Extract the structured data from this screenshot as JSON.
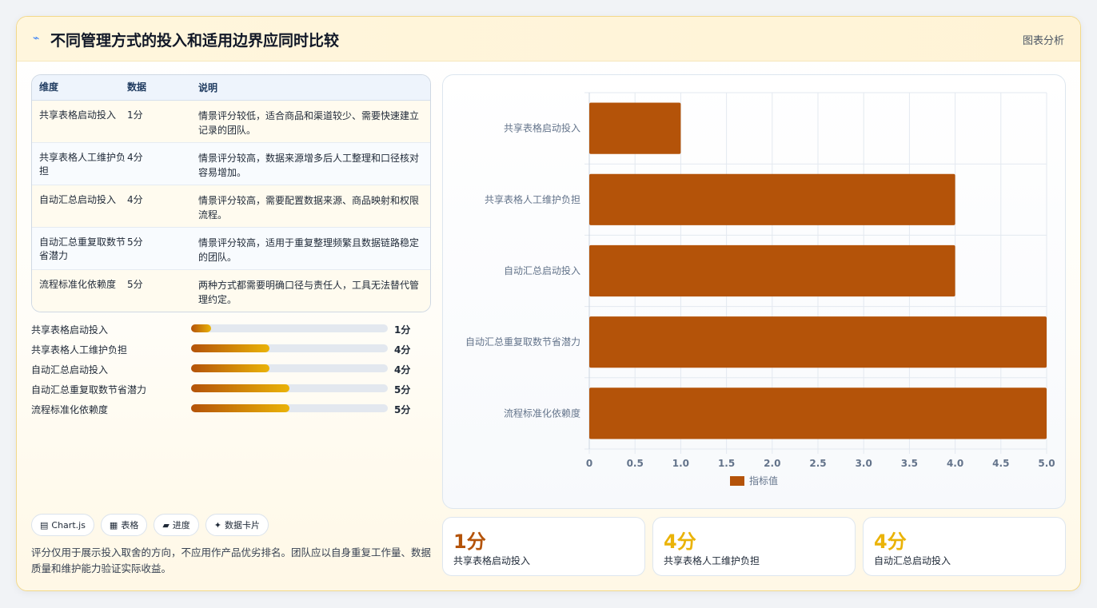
{
  "header": {
    "title": "不同管理方式的投入和适用边界应同时比较",
    "tag": "图表分析",
    "icon": "chart-spark-icon"
  },
  "table": {
    "headers": [
      "维度",
      "数据",
      "说明"
    ],
    "rows": [
      {
        "dim": "共享表格启动投入",
        "val": "1分",
        "desc": "情景评分较低，适合商品和渠道较少、需要快速建立记录的团队。"
      },
      {
        "dim": "共享表格人工维护负担",
        "val": "4分",
        "desc": "情景评分较高，数据来源增多后人工整理和口径核对容易增加。"
      },
      {
        "dim": "自动汇总启动投入",
        "val": "4分",
        "desc": "情景评分较高，需要配置数据来源、商品映射和权限流程。"
      },
      {
        "dim": "自动汇总重复取数节省潜力",
        "val": "5分",
        "desc": "情景评分较高，适用于重复整理频繁且数据链路稳定的团队。"
      },
      {
        "dim": "流程标准化依赖度",
        "val": "5分",
        "desc": "两种方式都需要明确口径与责任人，工具无法替代管理约定。"
      }
    ]
  },
  "progress": [
    {
      "label": "共享表格启动投入",
      "value": 1,
      "text": "1分"
    },
    {
      "label": "共享表格人工维护负担",
      "value": 4,
      "text": "4分"
    },
    {
      "label": "自动汇总启动投入",
      "value": 4,
      "text": "4分"
    },
    {
      "label": "自动汇总重复取数节省潜力",
      "value": 5,
      "text": "5分"
    },
    {
      "label": "流程标准化依赖度",
      "value": 5,
      "text": "5分"
    }
  ],
  "progress_max": 10,
  "chips": [
    {
      "icon": "chart-icon",
      "glyph": "▤",
      "label": "Chart.js"
    },
    {
      "icon": "table-icon",
      "glyph": "▦",
      "label": "表格"
    },
    {
      "icon": "progress-icon",
      "glyph": "▰",
      "label": "进度"
    },
    {
      "icon": "sparkle-icon",
      "glyph": "✦",
      "label": "数据卡片"
    }
  ],
  "note": "评分仅用于展示投入取舍的方向，不应用作产品优劣排名。团队应以自身重复工作量、数据质量和维护能力验证实际收益。",
  "metrics": [
    {
      "value": "1分",
      "label": "共享表格启动投入",
      "color": "#b45309"
    },
    {
      "value": "4分",
      "label": "共享表格人工维护负担",
      "color": "#eab308"
    },
    {
      "value": "4分",
      "label": "自动汇总启动投入",
      "color": "#eab308"
    }
  ],
  "chart_data": {
    "type": "bar",
    "orientation": "horizontal",
    "categories": [
      "共享表格启动投入",
      "共享表格人工维护负担",
      "自动汇总启动投入",
      "自动汇总重复取数节省潜力",
      "流程标准化依赖度"
    ],
    "series": [
      {
        "name": "指标值",
        "values": [
          1,
          4,
          4,
          5,
          5
        ],
        "color": "#b45309"
      }
    ],
    "xlim": [
      0,
      5
    ],
    "xticks": [
      "0",
      "0.5",
      "1.0",
      "1.5",
      "2.0",
      "2.5",
      "3.0",
      "3.5",
      "4.0",
      "4.5",
      "5.0"
    ],
    "grid": true,
    "legend": "bottom"
  }
}
